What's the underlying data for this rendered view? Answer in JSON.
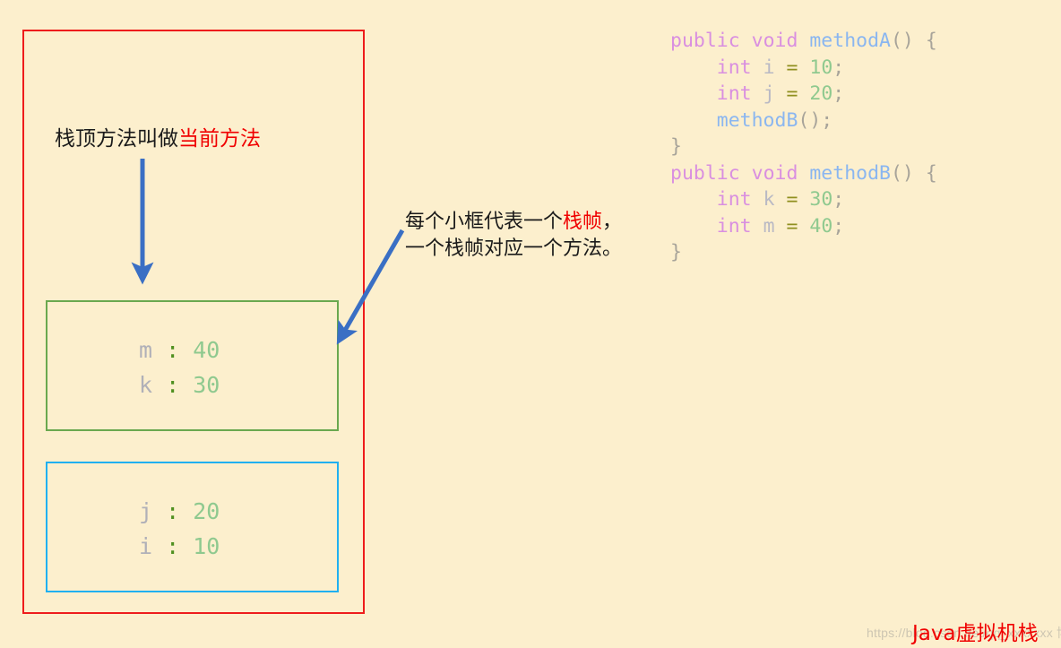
{
  "background_color": "#fcefcd",
  "stack": {
    "outer_box_name": "java-virtual-machine-stack",
    "outer_box_color": "#ee1c1c",
    "frames": [
      {
        "id": "frame-methodB",
        "border_color": "#6aa84f",
        "rows": [
          {
            "name": "m",
            "colon": ":",
            "value": "40"
          },
          {
            "name": "k",
            "colon": ":",
            "value": "30"
          }
        ]
      },
      {
        "id": "frame-methodA",
        "border_color": "#20b0f0",
        "rows": [
          {
            "name": "j",
            "colon": ":",
            "value": "20"
          },
          {
            "name": "i",
            "colon": ":",
            "value": "10"
          }
        ]
      }
    ]
  },
  "annotations": {
    "stack_top": {
      "plain": "栈顶方法叫做",
      "highlight": "当前方法",
      "highlight_color": "#f00000"
    },
    "frame_meaning": {
      "line1_plain": "每个小框代表一个",
      "line1_highlight": "栈帧",
      "line1_tail": "，",
      "line2": "一个栈帧对应一个方法。",
      "highlight_color": "#f00000"
    }
  },
  "arrows": {
    "color": "#3a6fc4",
    "down_arrow_name": "stack-growth-down-arrow",
    "pointer_arrow_name": "frame-pointer-arrow"
  },
  "code": {
    "lines": [
      [
        {
          "t": "public",
          "c": "kw"
        },
        {
          "t": " ",
          "c": "punct"
        },
        {
          "t": "void",
          "c": "kw"
        },
        {
          "t": " ",
          "c": "punct"
        },
        {
          "t": "methodA",
          "c": "fn"
        },
        {
          "t": "()",
          "c": "punct"
        },
        {
          "t": " ",
          "c": "punct"
        },
        {
          "t": "{",
          "c": "punct"
        }
      ],
      [
        {
          "t": "    ",
          "c": "punct"
        },
        {
          "t": "int",
          "c": "kw"
        },
        {
          "t": " ",
          "c": "punct"
        },
        {
          "t": "i",
          "c": "var"
        },
        {
          "t": " ",
          "c": "punct"
        },
        {
          "t": "=",
          "c": "op"
        },
        {
          "t": " ",
          "c": "punct"
        },
        {
          "t": "10",
          "c": "num"
        },
        {
          "t": ";",
          "c": "punct"
        }
      ],
      [
        {
          "t": "    ",
          "c": "punct"
        },
        {
          "t": "int",
          "c": "kw"
        },
        {
          "t": " ",
          "c": "punct"
        },
        {
          "t": "j",
          "c": "var"
        },
        {
          "t": " ",
          "c": "punct"
        },
        {
          "t": "=",
          "c": "op"
        },
        {
          "t": " ",
          "c": "punct"
        },
        {
          "t": "20",
          "c": "num"
        },
        {
          "t": ";",
          "c": "punct"
        }
      ],
      [
        {
          "t": "    ",
          "c": "punct"
        },
        {
          "t": "methodB",
          "c": "fn"
        },
        {
          "t": "();",
          "c": "punct"
        }
      ],
      [
        {
          "t": "}",
          "c": "punct"
        }
      ],
      [
        {
          "t": "public",
          "c": "kw"
        },
        {
          "t": " ",
          "c": "punct"
        },
        {
          "t": "void",
          "c": "kw"
        },
        {
          "t": " ",
          "c": "punct"
        },
        {
          "t": "methodB",
          "c": "fn"
        },
        {
          "t": "()",
          "c": "punct"
        },
        {
          "t": " ",
          "c": "punct"
        },
        {
          "t": "{",
          "c": "punct"
        }
      ],
      [
        {
          "t": "    ",
          "c": "punct"
        },
        {
          "t": "int",
          "c": "kw"
        },
        {
          "t": " ",
          "c": "punct"
        },
        {
          "t": "k",
          "c": "var"
        },
        {
          "t": " ",
          "c": "punct"
        },
        {
          "t": "=",
          "c": "op"
        },
        {
          "t": " ",
          "c": "punct"
        },
        {
          "t": "30",
          "c": "num"
        },
        {
          "t": ";",
          "c": "punct"
        }
      ],
      [
        {
          "t": "    ",
          "c": "punct"
        },
        {
          "t": "int",
          "c": "kw"
        },
        {
          "t": " ",
          "c": "punct"
        },
        {
          "t": "m",
          "c": "var"
        },
        {
          "t": " ",
          "c": "punct"
        },
        {
          "t": "=",
          "c": "op"
        },
        {
          "t": " ",
          "c": "punct"
        },
        {
          "t": "40",
          "c": "num"
        },
        {
          "t": ";",
          "c": "punct"
        }
      ],
      [
        {
          "t": "}",
          "c": "punct"
        }
      ]
    ],
    "token_colors": {
      "kw": "#d98fe0",
      "fn": "#8ab6f0",
      "var": "#b9b9c4",
      "num": "#8fc98f",
      "op": "#8f8f1f",
      "punct": "#a8a49a"
    }
  },
  "footer": {
    "caption": "Java虚拟机栈",
    "caption_color": "#f00000",
    "watermark": "https://blog.csdn.net/qq_xxxxxxx 博客"
  }
}
